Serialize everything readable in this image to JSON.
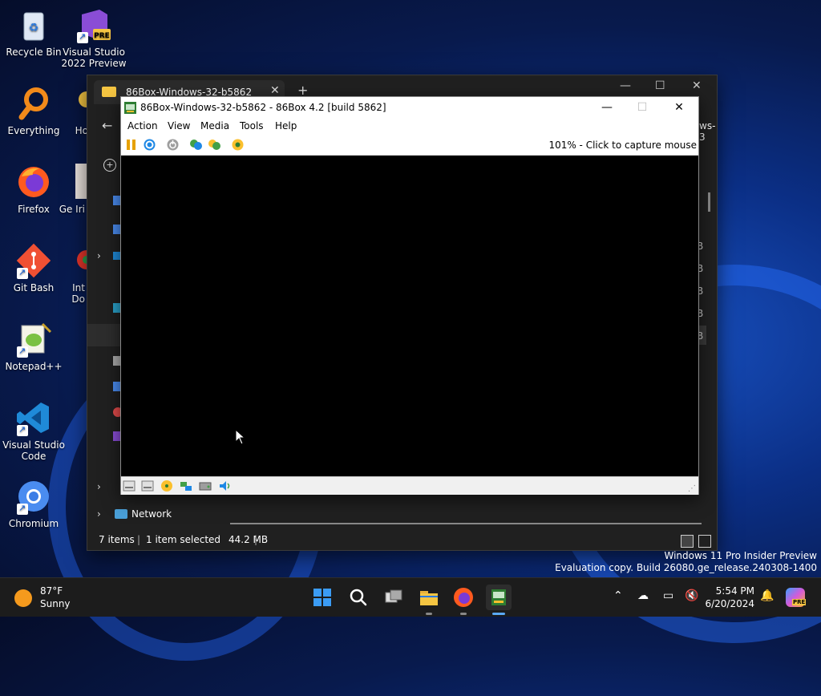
{
  "desktop": {
    "icons": [
      {
        "label": "Recycle Bin"
      },
      {
        "label": "Visual Studio 2022 Preview",
        "badge": "PRE"
      },
      {
        "label": "Everything"
      },
      {
        "label": "Ho"
      },
      {
        "label": "Firefox"
      },
      {
        "label": "Ge Iri"
      },
      {
        "label": "Git Bash"
      },
      {
        "label": "Int Do"
      },
      {
        "label": "Notepad++"
      },
      {
        "label": "Visual Studio Code"
      },
      {
        "label": "Chromium"
      }
    ]
  },
  "explorer": {
    "tab_title": "86Box-Windows-32-b5862",
    "nav_network": "Network",
    "status": {
      "items": "7 items",
      "selected": "1 item selected",
      "size": "44.2 MB"
    },
    "clipped_right": "ws-3",
    "clipped_sizes": [
      "B",
      "B",
      "B",
      "B",
      "B"
    ]
  },
  "box86": {
    "title": "86Box-Windows-32-b5862 - 86Box 4.2 [build 5862]",
    "menu": [
      "Action",
      "View",
      "Media",
      "Tools",
      "Help"
    ],
    "capture_hint": "101% - Click to capture mouse",
    "toolbar_icons": [
      "pause-icon",
      "reset-icon",
      "power-icon",
      "ctrl-alt-del-icon",
      "ctrl-alt-esc-icon",
      "settings-icon"
    ],
    "status_icons": [
      "floppy-a-icon",
      "floppy-b-icon",
      "cdrom-icon",
      "network-icon",
      "hard-disk-icon",
      "sound-icon"
    ]
  },
  "watermark": {
    "line1": "Windows 11 Pro Insider Preview",
    "line2": "Evaluation copy. Build 26080.ge_release.240308-1400"
  },
  "taskbar": {
    "weather_temp": "87°F",
    "weather_desc": "Sunny",
    "time": "5:54 PM",
    "date": "6/20/2024",
    "tray_badge": "PRE"
  }
}
